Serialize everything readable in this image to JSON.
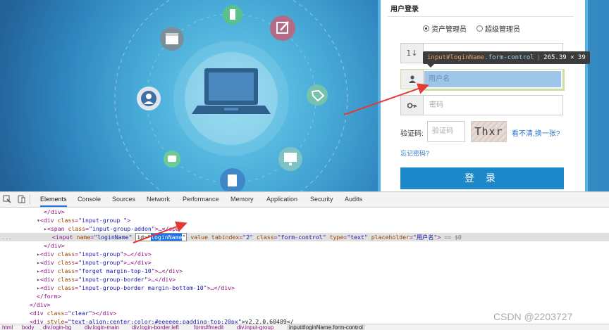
{
  "login": {
    "title": "用户登录",
    "radio_options": [
      {
        "label": "资产管理员",
        "selected": true
      },
      {
        "label": "超级管理员",
        "selected": false
      }
    ],
    "username_placeholder": "用户名",
    "password_placeholder": "密码",
    "verify_label": "验证码:",
    "verify_placeholder": "验证码",
    "captcha_text": "Thxr",
    "refresh_link": "看不清,换一张?",
    "forgot_link": "忘记密码?",
    "login_button": "登 录",
    "colors": {
      "primary": "#1d88c9",
      "link": "#2a73c9"
    }
  },
  "tooltip": {
    "selector": "input#loginName",
    "classes": ".form-control",
    "size": "265.39 × 39"
  },
  "devtools": {
    "tabs": [
      "Elements",
      "Console",
      "Sources",
      "Network",
      "Performance",
      "Memory",
      "Application",
      "Security",
      "Audits"
    ],
    "active_tab": "Elements",
    "code": {
      "l1_close_div": "</div>",
      "l2_open_tag": "<div ",
      "l2_attr": "class",
      "l2_val": "\"input-group \"",
      "l2_end": ">",
      "l3_open": "<span ",
      "l3_attr": "class",
      "l3_val": "\"input-group-addon\"",
      "l3_end": ">…</spa",
      "l4_open": "<input ",
      "l4_attr_name": "name",
      "l4_val_name": "\"loginName\"",
      "l4_attr_id": "id=\"",
      "l4_val_id": "loginName",
      "l4_id_close": "\"",
      "l4_attr_value": "value",
      "l4_attr_tab": "tabindex",
      "l4_val_tab": "\"2\"",
      "l4_attr_class": "class",
      "l4_val_class": "\"form-control\"",
      "l4_attr_type": "type",
      "l4_val_type": "\"text\"",
      "l4_attr_ph": "placeholder",
      "l4_val_ph": "\"用户名\"",
      "l4_end": ">",
      "l4_suffix": " == $0",
      "l5": "</div>",
      "l6_val": "\"input-group\"",
      "l6_end": ">…</div>",
      "l7_val": "\"input-group\"",
      "l7_end": ">…</div>",
      "l8_val": "\"forget margin-top-10\"",
      "l8_end": ">…</div>",
      "l9_val": "\"input-group-border\"",
      "l9_end": ">…</div>",
      "l10_val": "\"input-group-border margin-bottom-10\"",
      "l10_end": ">…</div>",
      "l11": "</form>",
      "l12": "</div>",
      "l13_val": "\"clear\"",
      "l13_end": "></div>",
      "l14_attr": "style",
      "l14_val": "\"text-align:center;color:#eeeeee;padding-top:20px\"",
      "l14_end": ">v2.2.0.60489</",
      "gutter": "..."
    },
    "breadcrumbs": [
      "html",
      "body",
      "div.login-bg",
      "div.login-main",
      "div.login-border.left",
      "form#fmedit",
      "div.input-group",
      "input#loginName.form-control"
    ]
  },
  "watermark": "CSDN @2203727"
}
